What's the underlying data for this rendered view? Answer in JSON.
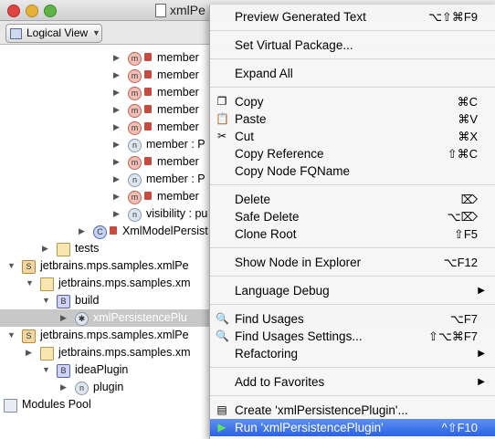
{
  "window": {
    "title": "xmlPe"
  },
  "toolbar": {
    "view_selector": "Logical View"
  },
  "tree": [
    {
      "label": "member",
      "icon": "m",
      "locked": true,
      "indent": 140,
      "toggle": "▶"
    },
    {
      "label": "member",
      "icon": "m",
      "locked": true,
      "indent": 140,
      "toggle": "▶"
    },
    {
      "label": "member",
      "icon": "m",
      "locked": true,
      "indent": 140,
      "toggle": "▶"
    },
    {
      "label": "member",
      "icon": "m",
      "locked": true,
      "indent": 140,
      "toggle": "▶"
    },
    {
      "label": "member",
      "icon": "m",
      "locked": true,
      "indent": 140,
      "toggle": "▶"
    },
    {
      "label": "member : P",
      "icon": "n",
      "locked": false,
      "indent": 140,
      "toggle": "▶"
    },
    {
      "label": "member",
      "icon": "m",
      "locked": true,
      "indent": 140,
      "toggle": "▶"
    },
    {
      "label": "member : P",
      "icon": "n",
      "locked": false,
      "indent": 140,
      "toggle": "▶"
    },
    {
      "label": "member",
      "icon": "m",
      "locked": true,
      "indent": 140,
      "toggle": "▶"
    },
    {
      "label": "visibility : pu",
      "icon": "n",
      "locked": false,
      "indent": 140,
      "toggle": "▶"
    },
    {
      "label": "XmlModelPersist",
      "icon": "c",
      "locked": true,
      "indent": 102,
      "toggle": "▶"
    },
    {
      "label": "tests",
      "icon": "fold",
      "locked": false,
      "indent": 62,
      "toggle": "▶"
    },
    {
      "label": "jetbrains.mps.samples.xmlPe",
      "icon": "s",
      "locked": false,
      "indent": 24,
      "toggle": "▼"
    },
    {
      "label": "jetbrains.mps.samples.xm",
      "icon": "fold",
      "locked": false,
      "indent": 44,
      "toggle": "▼"
    },
    {
      "label": "build",
      "icon": "build",
      "locked": false,
      "indent": 62,
      "toggle": "▼"
    },
    {
      "label": "xmlPersistencePlu",
      "icon": "bug",
      "locked": false,
      "indent": 82,
      "toggle": "▶",
      "selected": true
    },
    {
      "label": "jetbrains.mps.samples.xmlPe",
      "icon": "s",
      "locked": false,
      "indent": 24,
      "toggle": "▼"
    },
    {
      "label": "jetbrains.mps.samples.xm",
      "icon": "fold",
      "locked": false,
      "indent": 44,
      "toggle": "▶"
    },
    {
      "label": "ideaPlugin",
      "icon": "build",
      "locked": false,
      "indent": 62,
      "toggle": "▼"
    },
    {
      "label": "plugin",
      "icon": "n",
      "locked": false,
      "indent": 82,
      "toggle": "▶"
    },
    {
      "label": "Modules Pool",
      "icon": "pool",
      "locked": false,
      "indent": 4,
      "toggle": "▶"
    }
  ],
  "menu": [
    {
      "label": "Preview Generated Text",
      "shortcut": "⌥⇧⌘F9",
      "icon": ""
    },
    {
      "sep": true
    },
    {
      "label": "Set Virtual Package...",
      "shortcut": "",
      "icon": ""
    },
    {
      "sep": true
    },
    {
      "label": "Expand All",
      "shortcut": "",
      "icon": ""
    },
    {
      "sep": true
    },
    {
      "label": "Copy",
      "shortcut": "⌘C",
      "icon": "copy-icon"
    },
    {
      "label": "Paste",
      "shortcut": "⌘V",
      "icon": "paste-icon"
    },
    {
      "label": "Cut",
      "shortcut": "⌘X",
      "icon": "cut-icon"
    },
    {
      "label": "Copy Reference",
      "shortcut": "⇧⌘C",
      "icon": ""
    },
    {
      "label": "Copy Node FQName",
      "shortcut": "",
      "icon": ""
    },
    {
      "sep": true
    },
    {
      "label": "Delete",
      "shortcut": "⌦",
      "icon": ""
    },
    {
      "label": "Safe Delete",
      "shortcut": "⌥⌦",
      "icon": ""
    },
    {
      "label": "Clone Root",
      "shortcut": "⇧F5",
      "icon": ""
    },
    {
      "sep": true
    },
    {
      "label": "Show Node in Explorer",
      "shortcut": "⌥F12",
      "icon": ""
    },
    {
      "sep": true
    },
    {
      "label": "Language Debug",
      "shortcut": "",
      "icon": "",
      "submenu": true
    },
    {
      "sep": true
    },
    {
      "label": "Find Usages",
      "shortcut": "⌥F7",
      "icon": "search-icon"
    },
    {
      "label": "Find Usages Settings...",
      "shortcut": "⇧⌥⌘F7",
      "icon": "search-icon"
    },
    {
      "label": "Refactoring",
      "shortcut": "",
      "icon": "",
      "submenu": true
    },
    {
      "sep": true
    },
    {
      "label": "Add to Favorites",
      "shortcut": "",
      "icon": "",
      "submenu": true
    },
    {
      "sep": true
    },
    {
      "label": "Create 'xmlPersistencePlugin'...",
      "shortcut": "",
      "icon": "create-config-icon"
    },
    {
      "label": "Run 'xmlPersistencePlugin'",
      "shortcut": "^⇧F10",
      "icon": "run-icon",
      "highlighted": true
    }
  ]
}
